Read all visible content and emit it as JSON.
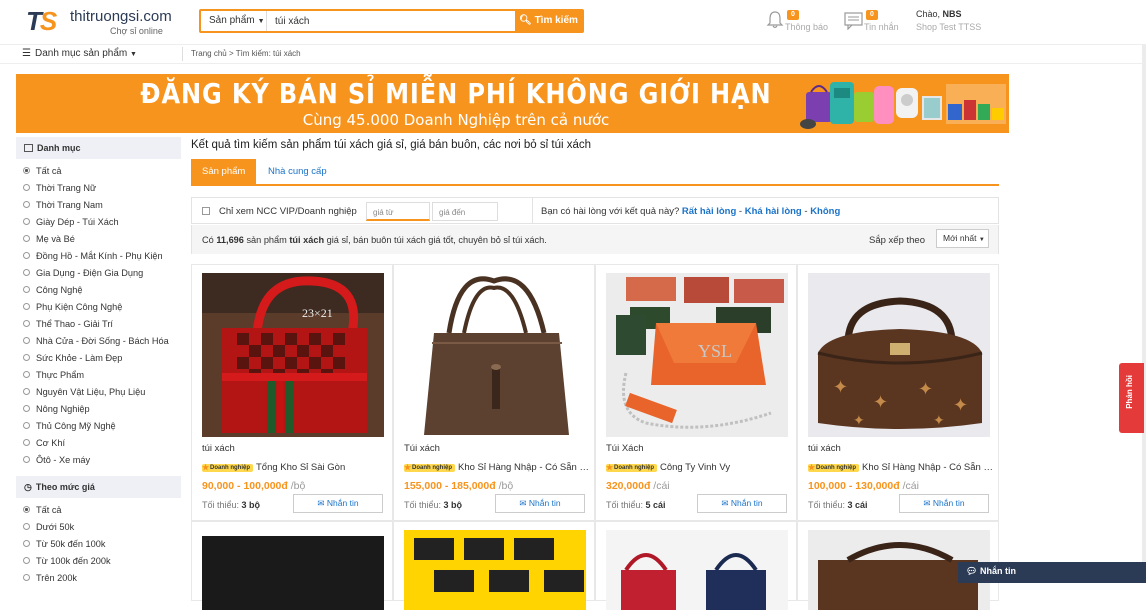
{
  "header": {
    "logo_mark": "TS",
    "logo_name": "thitruongsi.com",
    "logo_sub": "Chợ sỉ online",
    "search_category": "Sản phẩm",
    "search_value": "túi xách",
    "search_button": "Tìm kiếm",
    "notifications": {
      "count": "0",
      "label": "Thông báo"
    },
    "messages": {
      "count": "0",
      "label": "Tin nhắn"
    },
    "account_greeting": "Chào, ",
    "account_name": "NBS",
    "account_shop": "Shop Test TTSS"
  },
  "subbar": {
    "category_menu": "Danh mục sản phẩm",
    "breadcrumb": "Trang chủ  > Tìm kiếm: túi xách"
  },
  "banner": {
    "line1": "ĐĂNG KÝ BÁN SỈ MIỄN PHÍ KHÔNG GIỚI HẠN",
    "line2": "Cùng 45.000 Doanh Nghiệp trên cả nước"
  },
  "sidebar": {
    "category_title": "Danh mục",
    "categories": [
      "Tất cả",
      "Thời Trang Nữ",
      "Thời Trang Nam",
      "Giày Dép - Túi Xách",
      "Mẹ và Bé",
      "Đồng Hồ - Mắt Kính - Phụ Kiện",
      "Gia Dụng - Điện Gia Dụng",
      "Công Nghệ",
      "Phụ Kiện Công Nghệ",
      "Thể Thao - Giải Trí",
      "Nhà Cửa - Đời Sống - Bách Hóa",
      "Sức Khỏe - Làm Đẹp",
      "Thực Phẩm",
      "Nguyên Vật Liệu, Phụ Liệu",
      "Nông Nghiệp",
      "Thủ Công Mỹ Nghệ",
      "Cơ Khí",
      "Ôtô - Xe máy"
    ],
    "price_title": "Theo mức giá",
    "price_ranges": [
      "Tất cả",
      "Dưới 50k",
      "Từ 50k đến 100k",
      "Từ 100k đến 200k",
      "Trên 200k"
    ]
  },
  "main": {
    "result_title": "Kết quả tìm kiếm sản phẩm túi xách giá sỉ, giá bán buôn, các nơi bỏ sỉ túi xách",
    "tabs": [
      "Sản phẩm",
      "Nhà cung cấp"
    ],
    "filter_vip": "Chỉ xem NCC VIP/Doanh nghiệp",
    "price_from_placeholder": "giá từ",
    "price_to_placeholder": "giá đến",
    "rate_question": "Bạn có hài lòng với kết quả này? ",
    "rate_options": [
      "Rất hài lòng",
      "Khá hài lòng",
      "Không"
    ],
    "count_prefix": "Có ",
    "count_number": "11,696",
    "count_mid": " sản phẩm ",
    "count_keyword": "túi xách",
    "count_suffix": " giá sỉ, bán buôn túi xách giá tốt, chuyên bỏ sỉ túi xách.",
    "sort_label": "Sắp xếp theo",
    "sort_value": "Mới nhất"
  },
  "badge_label": "Doanh nghiệp",
  "min_label": "Tối thiểu: ",
  "chat_label": "Nhắn tin",
  "products": [
    {
      "name": "túi xách",
      "seller": "Tổng Kho Sỉ Sài Gòn",
      "price": "90,000 - 100,000đ",
      "unit": " /bộ",
      "min": "3 bộ"
    },
    {
      "name": "Túi xách",
      "seller": "Kho Sỉ Hàng Nhập - Có Sẵn Số Lượng",
      "price": "155,000 - 185,000đ",
      "unit": " /bộ",
      "min": "3 bộ"
    },
    {
      "name": "Túi Xách",
      "seller": "Công Ty Vinh Vy",
      "price": "320,000đ",
      "unit": " /cái",
      "min": "5 cái"
    },
    {
      "name": "túi xách",
      "seller": "Kho Sỉ Hàng Nhập - Có Sẵn Số Lượng",
      "price": "100,000 - 130,000đ",
      "unit": " /cái",
      "min": "3 cái"
    }
  ],
  "feedback_label": "Phản hồi",
  "chat_bar": "Nhắn tin",
  "colors": {
    "accent": "#f7941d",
    "link": "#1a73c9",
    "navy": "#2b3a55",
    "feedback": "#e53a3a"
  }
}
